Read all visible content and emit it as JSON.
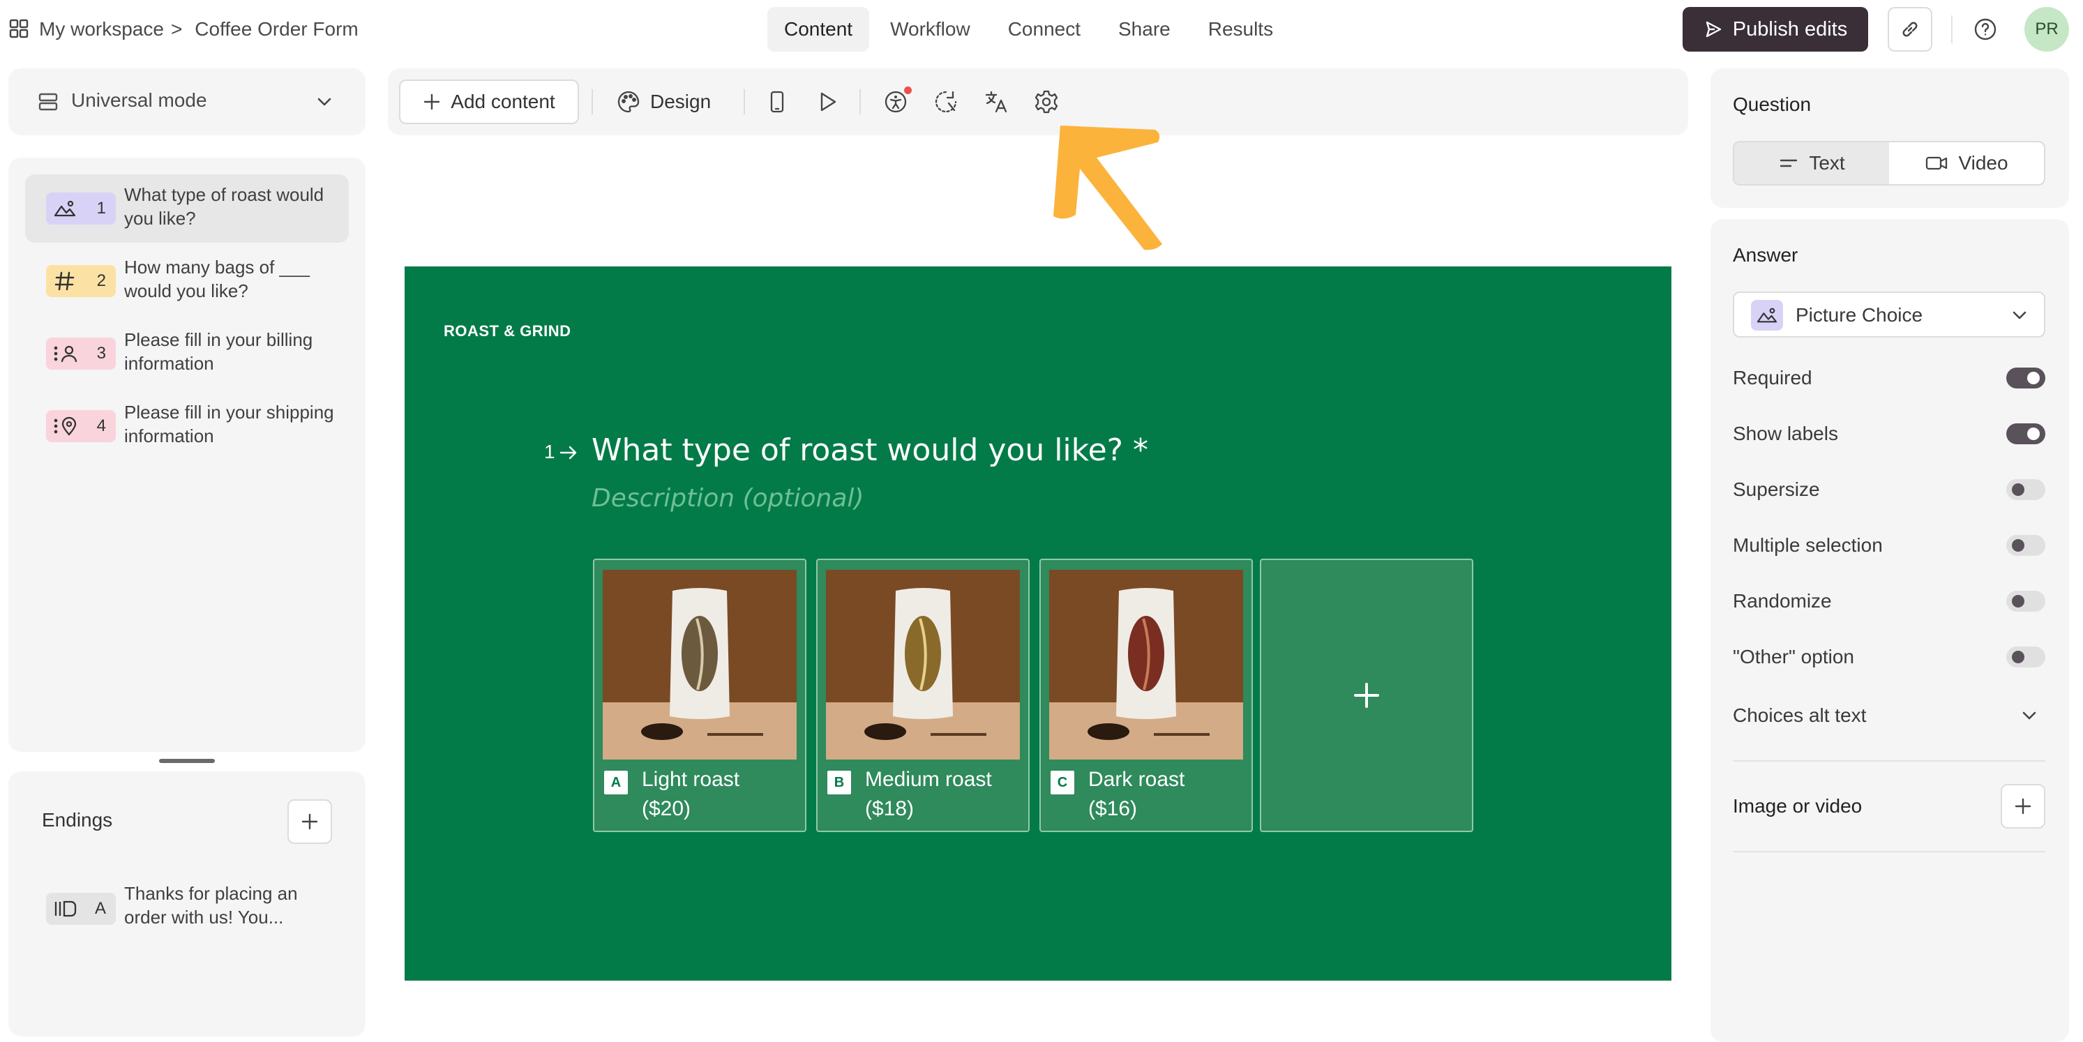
{
  "header": {
    "workspace": "My workspace",
    "separator": ">",
    "form_name": "Coffee Order Form",
    "tabs": [
      {
        "label": "Content",
        "active": true
      },
      {
        "label": "Workflow",
        "active": false
      },
      {
        "label": "Connect",
        "active": false
      },
      {
        "label": "Share",
        "active": false
      },
      {
        "label": "Results",
        "active": false
      }
    ],
    "publish_label": "Publish edits",
    "avatar_initials": "PR"
  },
  "sidebar": {
    "mode_label": "Universal mode",
    "questions": [
      {
        "num": "1",
        "text": "What type of roast would you like?",
        "icon": "picture-icon",
        "color": "#d9d2f7",
        "active": true
      },
      {
        "num": "2",
        "text": "How many bags of ___ would you like?",
        "icon": "hash-icon",
        "color": "#fbe2a4",
        "active": false
      },
      {
        "num": "3",
        "text": "Please fill in your billing information",
        "icon": "contact-icon",
        "color": "#f9d4dc",
        "active": false
      },
      {
        "num": "4",
        "text": "Please fill in your shipping information",
        "icon": "address-icon",
        "color": "#f9d4dc",
        "active": false
      }
    ],
    "endings_title": "Endings",
    "endings": [
      {
        "key": "A",
        "text": "Thanks for placing an order with us! You...",
        "icon": "ending-icon",
        "color": "#e4e4e4"
      }
    ]
  },
  "toolbar": {
    "add_content": "Add content",
    "design": "Design",
    "icons": [
      "mobile-icon",
      "play-icon",
      "accessibility-icon",
      "logic-icon",
      "translate-icon",
      "settings-icon"
    ]
  },
  "canvas": {
    "background": "#037b48",
    "brand": "ROAST & GRIND",
    "question_number": "1",
    "question_title": "What type of roast would you like? *",
    "description_placeholder": "Description (optional)",
    "choices": [
      {
        "key": "A",
        "label": "Light roast",
        "price": "($20)",
        "bean_color": "#6b5a3e"
      },
      {
        "key": "B",
        "label": "Medium roast",
        "price": "($18)",
        "bean_color": "#8a6a2a"
      },
      {
        "key": "C",
        "label": "Dark roast",
        "price": "($16)",
        "bean_color": "#7a2e22"
      }
    ],
    "add_choice_symbol": "+"
  },
  "question_panel": {
    "title": "Question",
    "options": [
      "Text",
      "Video"
    ],
    "selected": "Text"
  },
  "answer_panel": {
    "title": "Answer",
    "answer_type": "Picture Choice",
    "settings": [
      {
        "label": "Required",
        "on": true
      },
      {
        "label": "Show labels",
        "on": true
      },
      {
        "label": "Supersize",
        "on": false
      },
      {
        "label": "Multiple selection",
        "on": false
      },
      {
        "label": "Randomize",
        "on": false
      },
      {
        "label": "\"Other\" option",
        "on": false
      }
    ],
    "choices_alt_text": "Choices alt text",
    "image_or_video": "Image or video"
  },
  "colors": {
    "accent_arrow": "#fbb33c",
    "publish_bg": "#3a2f37",
    "notification_dot": "#ef4e4e"
  }
}
